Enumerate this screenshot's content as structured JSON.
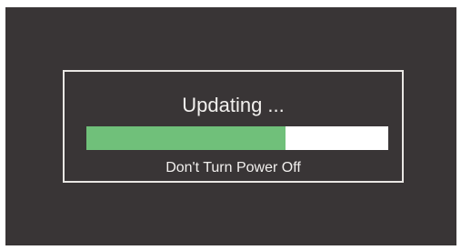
{
  "dialog": {
    "title": "Updating ...",
    "progress": 0.66,
    "caption": "Don't Turn Power Off"
  },
  "colors": {
    "screen_background": "#393536",
    "dialog_border": "#e9e7e4",
    "progress_fill": "#70c07a",
    "progress_track": "#ffffff",
    "text": "#f2f0ee"
  }
}
